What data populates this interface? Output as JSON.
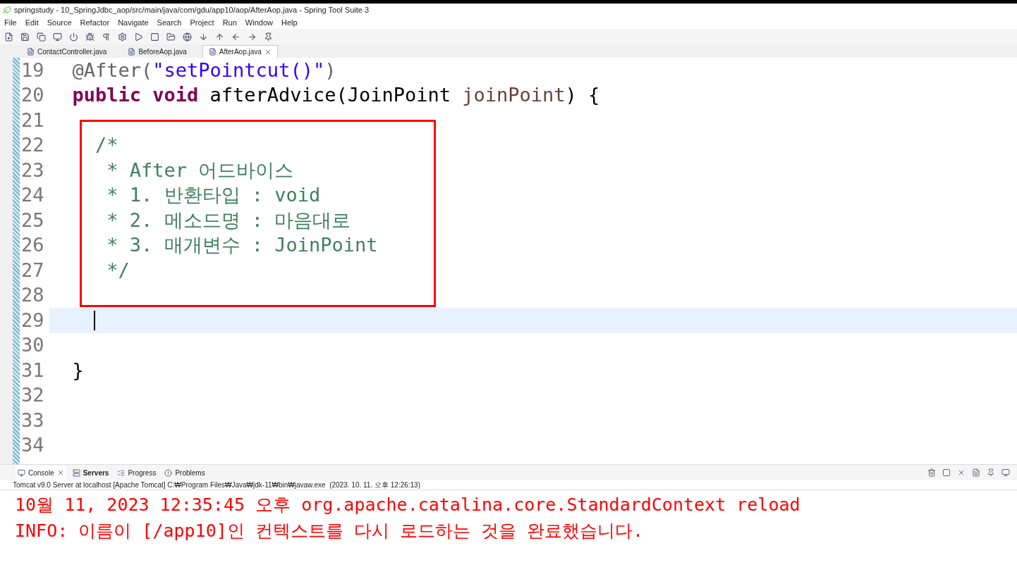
{
  "window": {
    "title": "springstudy - 10_SpringJdbc_aop/src/main/java/com/gdu/app10/aop/AfterAop.java - Spring Tool Suite 3"
  },
  "menu": [
    "File",
    "Edit",
    "Source",
    "Refactor",
    "Navigate",
    "Search",
    "Project",
    "Run",
    "Window",
    "Help"
  ],
  "editor_tabs": [
    {
      "label": "ContactController.java",
      "selected": false
    },
    {
      "label": "BeforeAop.java",
      "selected": false
    },
    {
      "label": "AfterAop.java",
      "selected": true
    }
  ],
  "code_lines": [
    {
      "number": "19",
      "current": false,
      "tokens": [
        {
          "kind": "annotation",
          "text": "  @After("
        },
        {
          "kind": "string",
          "text": "\"setPointcut()\""
        },
        {
          "kind": "annotation",
          "text": ")"
        }
      ]
    },
    {
      "number": "20",
      "current": false,
      "tokens": [
        {
          "kind": "keyword",
          "text": "  public void "
        },
        {
          "kind": "plain",
          "text": "afterAdvice(JoinPoint "
        },
        {
          "kind": "param",
          "text": "joinPoint"
        },
        {
          "kind": "plain",
          "text": ") {"
        }
      ]
    },
    {
      "number": "21",
      "current": false
    },
    {
      "number": "22",
      "current": false,
      "tokens": [
        {
          "kind": "comment",
          "text": "    /*"
        }
      ]
    },
    {
      "number": "23",
      "current": false,
      "tokens": [
        {
          "kind": "comment",
          "text": "     * After 어드바이스"
        }
      ]
    },
    {
      "number": "24",
      "current": false,
      "tokens": [
        {
          "kind": "comment",
          "text": "     * 1. 반환타입 : void"
        }
      ]
    },
    {
      "number": "25",
      "current": false,
      "tokens": [
        {
          "kind": "comment",
          "text": "     * 2. 메소드명 : 마음대로"
        }
      ]
    },
    {
      "number": "26",
      "current": false,
      "tokens": [
        {
          "kind": "comment",
          "text": "     * 3. 매개변수 : JoinPoint"
        }
      ]
    },
    {
      "number": "27",
      "current": false,
      "tokens": [
        {
          "kind": "comment",
          "text": "     */"
        }
      ]
    },
    {
      "number": "28",
      "current": false
    },
    {
      "number": "29",
      "current": true
    },
    {
      "number": "30",
      "current": false
    },
    {
      "number": "31",
      "current": false,
      "tokens": [
        {
          "kind": "plain",
          "text": "  }"
        }
      ]
    },
    {
      "number": "32",
      "current": false
    },
    {
      "number": "33",
      "current": false
    },
    {
      "number": "34",
      "current": false
    }
  ],
  "console": {
    "tabs": [
      {
        "label": "Console",
        "selected": true,
        "bold": false
      },
      {
        "label": "Servers",
        "selected": false,
        "bold": true
      },
      {
        "label": "Progress",
        "selected": false,
        "bold": false
      },
      {
        "label": "Problems",
        "selected": false,
        "bold": false
      }
    ],
    "description": "Tomcat v9.0 Server at localhost [Apache Tomcat] C:₩Program Files₩Java₩jdk-11₩bin₩javaw.exe  (2023. 10. 11. 오후 12:26:13)",
    "output": [
      "10월 11, 2023 12:35:45 오후 org.apache.catalina.core.StandardContext reload",
      "INFO: 이름이 [/app10]인 컨텍스트를 다시 로드하는 것을 완료했습니다."
    ]
  }
}
